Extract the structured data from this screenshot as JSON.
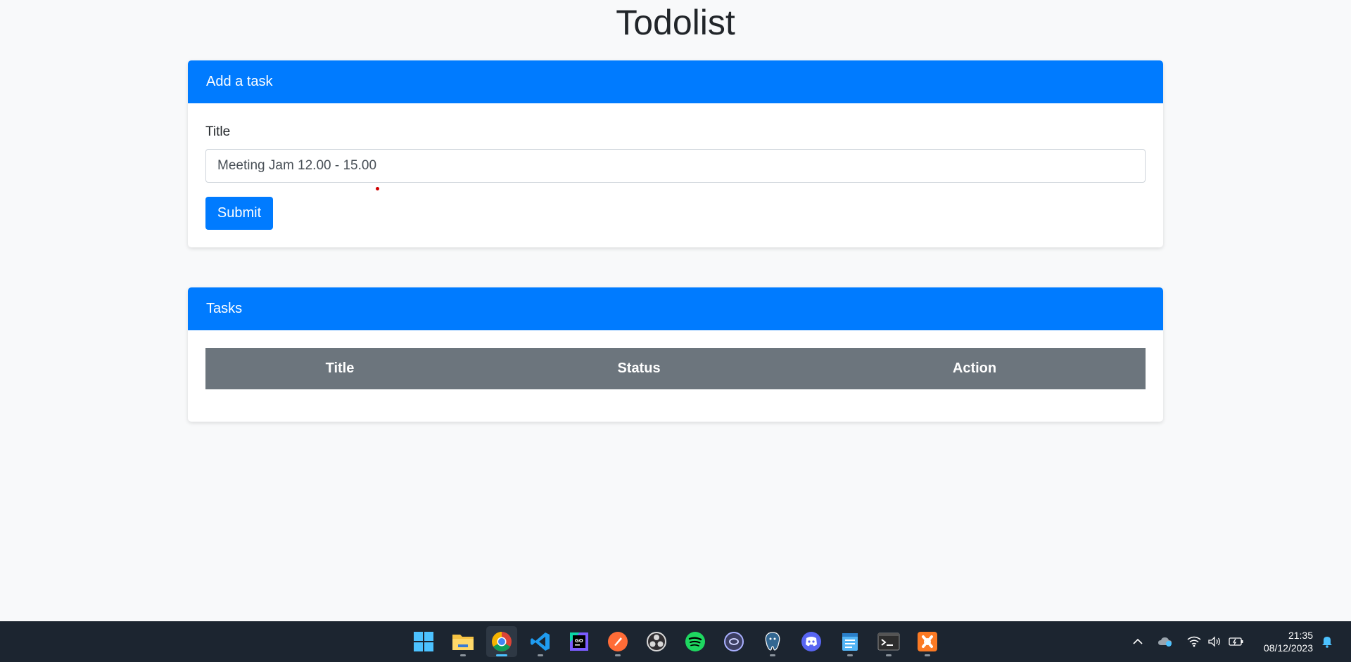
{
  "page": {
    "title": "Todolist"
  },
  "add_task": {
    "header": "Add a task",
    "label": "Title",
    "input_value": "Meeting Jam 12.00 - 15.00",
    "submit_label": "Submit"
  },
  "tasks": {
    "header": "Tasks",
    "columns": [
      "Title",
      "Status",
      "Action"
    ],
    "rows": []
  },
  "taskbar": {
    "apps": [
      "start-icon",
      "file-explorer-icon",
      "chrome-icon",
      "vscode-icon",
      "goland-icon",
      "postman-icon",
      "obs-icon",
      "spotify-icon",
      "app-icon",
      "pgadmin-icon",
      "discord-icon",
      "notepad-icon",
      "terminal-icon",
      "xampp-icon"
    ],
    "time": "21:35",
    "date": "08/12/2023"
  },
  "colors": {
    "primary": "#007bff",
    "table_header": "#6c757d",
    "background": "#f8f9fa",
    "taskbar": "#1c2530"
  }
}
